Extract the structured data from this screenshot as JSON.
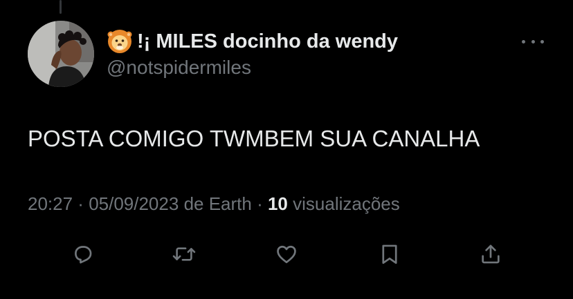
{
  "tweet": {
    "author": {
      "emoji": "🦁",
      "display_name": "!¡ MILES docinho da wendy",
      "handle": "@notspidermiles",
      "avatar_icon": "user-avatar"
    },
    "text": "POSTA COMIGO TWMBEM SUA CANALHA",
    "meta": {
      "time": "20:27",
      "separator": " · ",
      "date": "05/09/2023",
      "source": "de Earth",
      "views_count": "10",
      "views_label": "visualizações"
    },
    "actions": [
      {
        "name": "reply",
        "icon": "reply-icon"
      },
      {
        "name": "retweet",
        "icon": "retweet-icon"
      },
      {
        "name": "like",
        "icon": "heart-icon"
      },
      {
        "name": "bookmark",
        "icon": "bookmark-icon"
      },
      {
        "name": "share",
        "icon": "share-icon"
      }
    ]
  },
  "colors": {
    "background": "#000000",
    "primary_text": "#e7e9ea",
    "secondary_text": "#71767b",
    "icon": "#71767b"
  }
}
